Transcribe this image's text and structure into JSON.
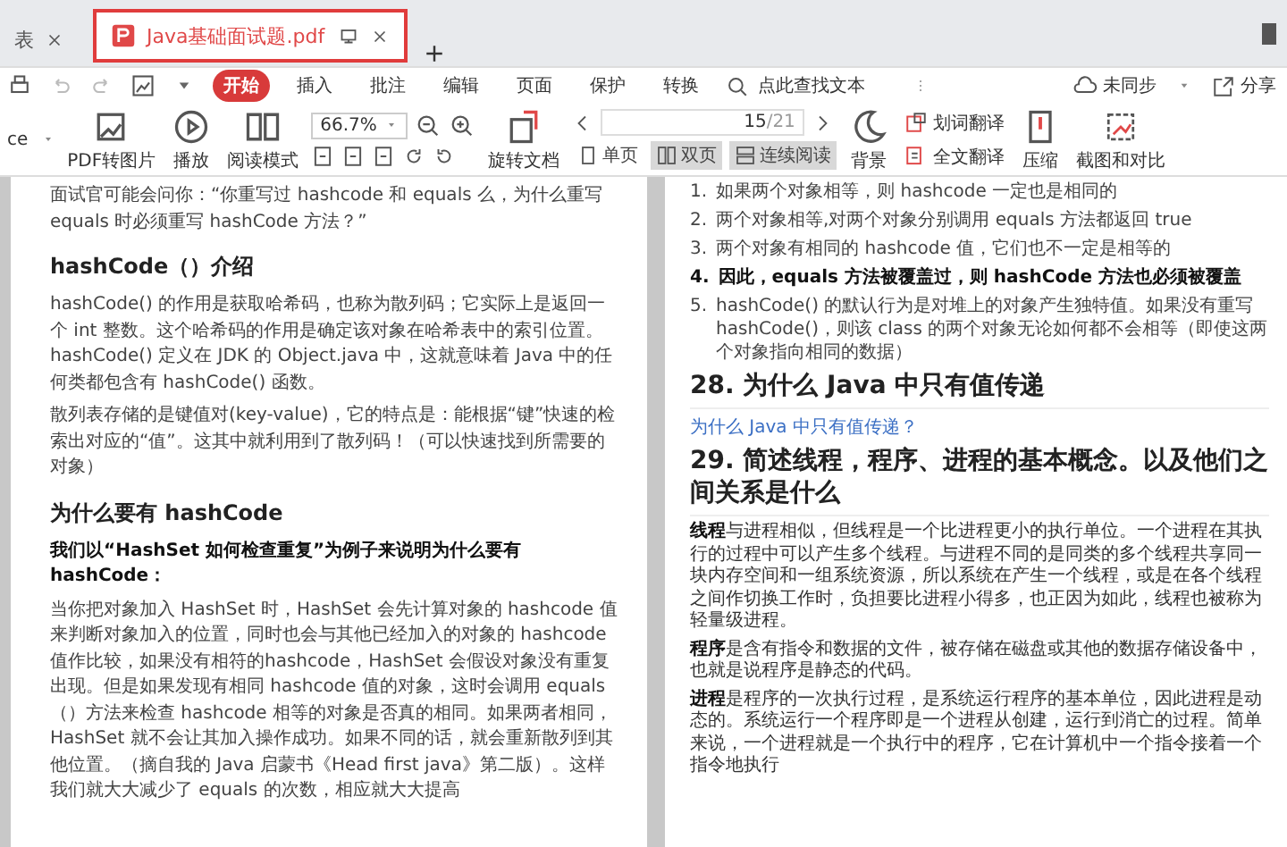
{
  "tabs": [
    {
      "label": "表",
      "selected": false
    },
    {
      "label": "Java基础面试题.pdf",
      "selected": true
    }
  ],
  "menu": [
    {
      "label": "开始",
      "selected": true
    },
    {
      "label": "插入",
      "selected": false
    },
    {
      "label": "批注",
      "selected": false
    },
    {
      "label": "编辑",
      "selected": false
    },
    {
      "label": "页面",
      "selected": false
    },
    {
      "label": "保护",
      "selected": false
    },
    {
      "label": "转换",
      "selected": false
    }
  ],
  "search": {
    "placeholder": "点此查找文本"
  },
  "sync": {
    "label": "未同步"
  },
  "share": {
    "label": "分享"
  },
  "toolbar": {
    "cut_label": "ce",
    "pdf_to_image": "PDF转图片",
    "play": "播放",
    "read_mode": "阅读模式",
    "zoom": "66.7%",
    "rotate": "旋转文档",
    "page": "15",
    "page_total": "/21",
    "views": [
      {
        "label": "单页",
        "selected": false
      },
      {
        "label": "双页",
        "selected": true
      },
      {
        "label": "连续阅读",
        "selected": true
      }
    ],
    "background": "背景",
    "word_translate": "划词翻译",
    "full_translate": "全文翻译",
    "compress": "压缩",
    "screenshot_compare": "截图和对比"
  },
  "left_page": [
    {
      "kind": "p",
      "text": "面试官可能会问你：“你重写过 hashcode 和 equals 么，为什么重写 equals 时必须重写 hashCode 方法？”"
    },
    {
      "kind": "h3",
      "text": "hashCode（）介绍"
    },
    {
      "kind": "p",
      "text": "hashCode() 的作用是获取哈希码，也称为散列码；它实际上是返回一个 int 整数。这个哈希码的作用是确定该对象在哈希表中的索引位置。hashCode() 定义在 JDK 的 Object.java 中，这就意味着 Java 中的任何类都包含有 hashCode() 函数。"
    },
    {
      "kind": "p",
      "text": "散列表存储的是键值对(key-value)，它的特点是：能根据“键”快速的检索出对应的“值”。这其中就利用到了散列码！（可以快速找到所需要的对象）"
    },
    {
      "kind": "h3",
      "text": "为什么要有 hashCode"
    },
    {
      "kind": "b",
      "text": "我们以“HashSet 如何检查重复”为例子来说明为什么要有 hashCode："
    },
    {
      "kind": "p",
      "text": "当你把对象加入 HashSet 时，HashSet 会先计算对象的 hashcode 值来判断对象加入的位置，同时也会与其他已经加入的对象的 hashcode 值作比较，如果没有相符的hashcode，HashSet 会假设对象没有重复出现。但是如果发现有相同 hashcode 值的对象，这时会调用 equals（）方法来检查 hashcode 相等的对象是否真的相同。如果两者相同，HashSet 就不会让其加入操作成功。如果不同的话，就会重新散列到其他位置。（摘自我的 Java 启蒙书《Head first java》第二版）。这样我们就大大减少了 equals 的次数，相应就大大提高"
    }
  ],
  "right_page": [
    {
      "kind": "li",
      "marker": "1.",
      "text": "如果两个对象相等，则 hashcode 一定也是相同的"
    },
    {
      "kind": "li",
      "marker": "2.",
      "text": "两个对象相等,对两个对象分别调用 equals 方法都返回 true"
    },
    {
      "kind": "li",
      "marker": "3.",
      "text": "两个对象有相同的 hashcode 值，它们也不一定是相等的"
    },
    {
      "kind": "lib",
      "marker": "4.",
      "text": "因此，equals 方法被覆盖过，则 hashCode 方法也必须被覆盖"
    },
    {
      "kind": "li",
      "marker": "5.",
      "text": "hashCode() 的默认行为是对堆上的对象产生独特值。如果没有重写 hashCode()，则该 class 的两个对象无论如何都不会相等（即使这两个对象指向相同的数据）"
    },
    {
      "kind": "h2",
      "text": "28. 为什么 Java 中只有值传递"
    },
    {
      "kind": "link",
      "text": "为什么 Java 中只有值传递？"
    },
    {
      "kind": "h2",
      "text": "29. 简述线程，程序、进程的基本概念。以及他们之间关系是什么"
    },
    {
      "kind": "p",
      "text": "**线程**与进程相似，但线程是一个比进程更小的执行单位。一个进程在其执行的过程中可以产生多个线程。与进程不同的是同类的多个线程共享同一块内存空间和一组系统资源，所以系统在产生一个线程，或是在各个线程之间作切换工作时，负担要比进程小得多，也正因为如此，线程也被称为轻量级进程。"
    },
    {
      "kind": "p",
      "text": "**程序**是含有指令和数据的文件，被存储在磁盘或其他的数据存储设备中，也就是说程序是静态的代码。"
    },
    {
      "kind": "p",
      "text": "**进程**是程序的一次执行过程，是系统运行程序的基本单位，因此进程是动态的。系统运行一个程序即是一个进程从创建，运行到消亡的过程。简单来说，一个进程就是一个执行中的程序，它在计算机中一个指令接着一个指令地执行"
    }
  ]
}
